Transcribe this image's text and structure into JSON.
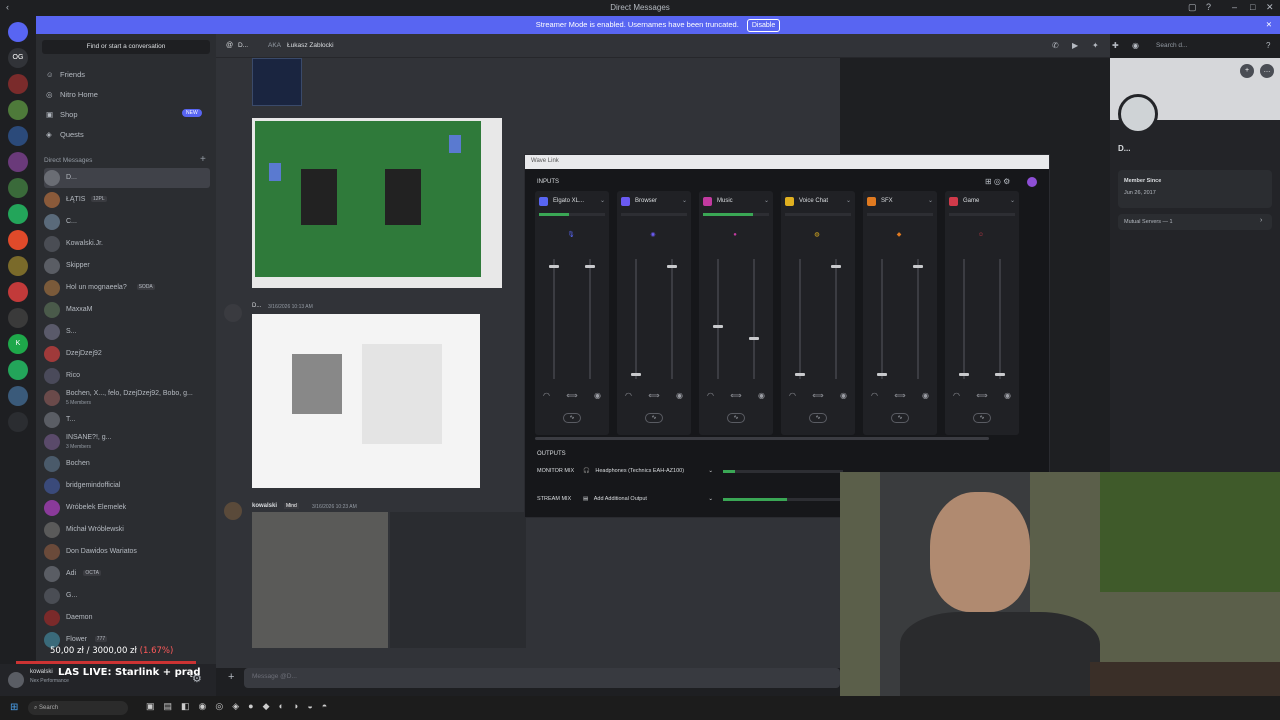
{
  "window": {
    "title": "Direct Messages"
  },
  "banner": {
    "text": "Streamer Mode is enabled. Usernames have been truncated.",
    "disable_label": "Disable"
  },
  "servers": [
    {
      "label": "",
      "color": "#5865f2"
    },
    {
      "label": "OG",
      "color": "#313338"
    },
    {
      "label": "",
      "color": "#7a2b2b"
    },
    {
      "label": "",
      "color": "#4e7a3a"
    },
    {
      "label": "",
      "color": "#2b4a7a"
    },
    {
      "label": "",
      "color": "#6a3a7a"
    },
    {
      "label": "",
      "color": "#3a6a3a"
    },
    {
      "label": "",
      "color": "#23a55a"
    },
    {
      "label": "",
      "color": "#e04a2a"
    },
    {
      "label": "",
      "color": "#7a6a2a"
    },
    {
      "label": "",
      "color": "#c23a3a"
    },
    {
      "label": "",
      "color": "#3a3a3a"
    },
    {
      "label": "K",
      "color": "#1ea84a"
    },
    {
      "label": "",
      "color": "#23a55a"
    },
    {
      "label": "",
      "color": "#3a5a7a"
    },
    {
      "label": "",
      "color": "#2b2d31"
    }
  ],
  "dm_sidebar": {
    "search_placeholder": "Find or start a conversation",
    "nav": [
      "Friends",
      "Nitro Home",
      "Shop",
      "Quests"
    ],
    "shop_badge": "NEW",
    "section_title": "Direct Messages",
    "add_icon": "plus-icon",
    "dms": [
      {
        "name": "D...",
        "sub": "",
        "color": "#6a6d74"
      },
      {
        "name": "ŁĄTIS",
        "sub": "",
        "color": "#8a5a3a",
        "tag": "12PL"
      },
      {
        "name": "C...",
        "sub": "",
        "color": "#5a6a7a"
      },
      {
        "name": "Kowalski.Jr.",
        "sub": "",
        "color": "#4a4d54"
      },
      {
        "name": "Skipper",
        "sub": "",
        "color": "#5a5d64"
      },
      {
        "name": "Hol un mognaeela?",
        "sub": "",
        "color": "#7a5a3a",
        "tag": "SODA"
      },
      {
        "name": "MaxxaM",
        "sub": "",
        "color": "#4a5a4a"
      },
      {
        "name": "S...",
        "sub": "",
        "color": "#5a5a6a"
      },
      {
        "name": "DzejDzej92",
        "sub": "",
        "color": "#a03a3a"
      },
      {
        "name": "Rico",
        "sub": "",
        "color": "#4a4a5a"
      },
      {
        "name": "Bochen, X..., felo, DzejDzej92, Bobo, g...",
        "sub": "5 Members",
        "color": "#6a4a4a"
      },
      {
        "name": "T...",
        "sub": "",
        "color": "#5a5d64"
      },
      {
        "name": "INSANE?!, g...",
        "sub": "3 Members",
        "color": "#5a4a6a"
      },
      {
        "name": "Bochen",
        "sub": "",
        "color": "#4a5a6a"
      },
      {
        "name": "bridgemindofficial",
        "sub": "",
        "color": "#3a4a7a"
      },
      {
        "name": "Wróbelek Elemelek",
        "sub": "",
        "color": "#8a3a9a"
      },
      {
        "name": "Michał Wróblewski",
        "sub": "",
        "color": "#5a5a5a"
      },
      {
        "name": "Don Dawidos Wariatos",
        "sub": "",
        "color": "#6a4a3a"
      },
      {
        "name": "Adi",
        "sub": "",
        "color": "#5a5d64",
        "tag": "OCTA"
      },
      {
        "name": "G...",
        "sub": "",
        "color": "#4a4d54"
      },
      {
        "name": "Daemon",
        "sub": "",
        "color": "#7a2a2a"
      },
      {
        "name": "Flower",
        "sub": "",
        "color": "#3a6a7a",
        "tag": "777"
      }
    ]
  },
  "chat_header": {
    "name": "D...",
    "aka_label": "AKA",
    "aka_value": "Łukasz Zablocki",
    "search_placeholder": "Search d..."
  },
  "messages": [
    {
      "author": "D...",
      "time": "3/16/2026 10:13 AM"
    },
    {
      "author": "kowalski",
      "tag": "Mind",
      "time": "3/16/2026 10:23 AM"
    }
  ],
  "compose": {
    "placeholder": "Message @D..."
  },
  "profile": {
    "name": "D...",
    "member_since_label": "Member Since",
    "member_since": "Jun 26, 2017",
    "mutual_servers": "Mutual Servers — 1"
  },
  "mixer": {
    "title": "Wave Link",
    "inputs_label": "INPUTS",
    "outputs_label": "OUTPUTS",
    "channels": [
      {
        "name": "Elgato XL...",
        "color": "#5865f2",
        "level": 0.45,
        "app_icon": "microphone-icon",
        "fader_a": 0.05,
        "fader_b": 0.95
      },
      {
        "name": "Browser",
        "color": "#6a5af2",
        "level": 0.0,
        "app_icon": "chrome-icon",
        "fader_a": 0.95,
        "fader_b": 0.95
      },
      {
        "name": "Music",
        "color": "#c23aa0",
        "level": 0.75,
        "app_icon": "spotify-icon",
        "fader_a": 0.55,
        "fader_b": 0.35
      },
      {
        "name": "Voice Chat",
        "color": "#e0b020",
        "level": 0.0,
        "app_icon": "discord-icon",
        "fader_a": 0.95,
        "fader_b": 0.95
      },
      {
        "name": "SFX",
        "color": "#e07a20",
        "level": 0.0,
        "app_icon": "sfx-icon",
        "fader_a": 0.95,
        "fader_b": 0.95
      },
      {
        "name": "Game",
        "color": "#d03a4a",
        "level": 0.0,
        "app_icon": "gamepad-icon",
        "fader_a": 0.95,
        "fader_b": 0.05
      }
    ],
    "monitor_mix_label": "MONITOR MIX",
    "monitor_device": "Headphones (Technics EAH-AZ100)",
    "stream_mix_label": "STREAM MIX",
    "stream_device": "Add Additional Output"
  },
  "overlay": {
    "donation": "50,00 zł",
    "goal": "3000,00 zł",
    "percent": "(1.67%)",
    "live_title": "LAS LIVE: Starlink + prąd"
  },
  "user_panel": {
    "name": "kowalski",
    "status": "Nex Performance"
  },
  "taskbar": {
    "search_placeholder": "Search"
  }
}
